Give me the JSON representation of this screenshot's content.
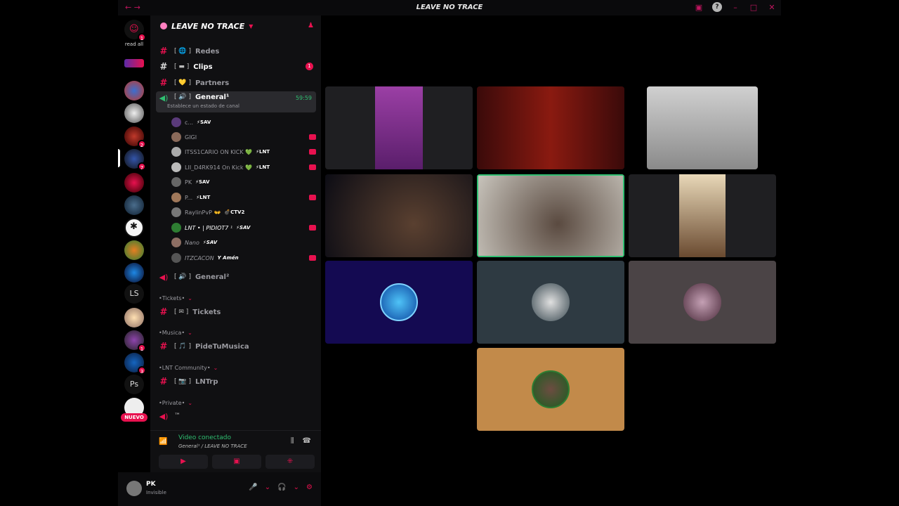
{
  "window": {
    "title": "LEAVE NO TRACE",
    "nav": "← →"
  },
  "server": {
    "name": "LEAVE NO TRACE",
    "read_all": "read all",
    "nuevo": "NUEVO",
    "guild_text_1": "LS",
    "guild_text_2": "Ps"
  },
  "badges": {
    "top": "1",
    "g5": "2",
    "g6": "7",
    "g15": "3",
    "g16": "1",
    "g17": "3"
  },
  "channels": {
    "redes": {
      "deco": "[ 🌐 ]",
      "name": "Redes"
    },
    "clips": {
      "deco": "[ ▬ ]",
      "name": "Clips",
      "unread": "1"
    },
    "partners": {
      "deco": "[ 💛 ]",
      "name": "Partners"
    },
    "general1": {
      "deco": "[ 🔊 ]",
      "name": "General¹",
      "timer": "59:59",
      "status": "Establece un estado de canal"
    },
    "general2": {
      "deco": "[ 🔊 ]",
      "name": "General²"
    },
    "tickets": {
      "deco": "[ ✉ ]",
      "name": "Tickets"
    },
    "pidetumusica": {
      "deco": "[ 🎵 ]",
      "name": "PideTuMusica"
    },
    "lntrp": {
      "deco": "[ 📷 ]",
      "name": "LNTrp"
    },
    "private_first": "™"
  },
  "categories": {
    "tickets": "•Tickets•",
    "musica": "•Musica•",
    "community": "•LNT Community•",
    "private": "•Private•"
  },
  "members": [
    {
      "name": "c...",
      "tag": "⚡SAV",
      "live": false
    },
    {
      "name": "GIGI",
      "tag": "",
      "live": true
    },
    {
      "name": "ITSS1CARIO ON KICK 💚",
      "tag": "⚡LNT",
      "live": true
    },
    {
      "name": "LII_D4RK914 On Kick 💚",
      "tag": "⚡LNT",
      "live": true
    },
    {
      "name": "PK",
      "tag": "⚡SAV",
      "live": false
    },
    {
      "name": "P...",
      "tag": "⚡LNT",
      "live": true
    },
    {
      "name": "RaylinPvP 👐",
      "tag": "💣CTV2",
      "live": false
    },
    {
      "name": "LNT • | PIDIOT7 ¹",
      "tag": "⚡SAV",
      "live": true
    },
    {
      "name": "Nano",
      "tag": "⚡SAV",
      "live": false
    },
    {
      "name": "ITZCACON",
      "tag": "Y Amén",
      "live": true
    }
  ],
  "voice": {
    "connected": "Video conectado",
    "location": "General¹ / LEAVE NO TRACE"
  },
  "user": {
    "name": "PK",
    "status": "Invisible"
  },
  "colors": {
    "accent": "#e8114f",
    "voice_green": "#2fbf71",
    "bg": "#000000",
    "panel": "#101012"
  },
  "icons": [
    "hash-icon",
    "speaker-icon",
    "signal-icon",
    "soundboard-icon",
    "disconnect-icon",
    "mic-icon",
    "headphones-icon",
    "gear-icon",
    "add-user-icon",
    "help-icon",
    "inbox-icon"
  ]
}
